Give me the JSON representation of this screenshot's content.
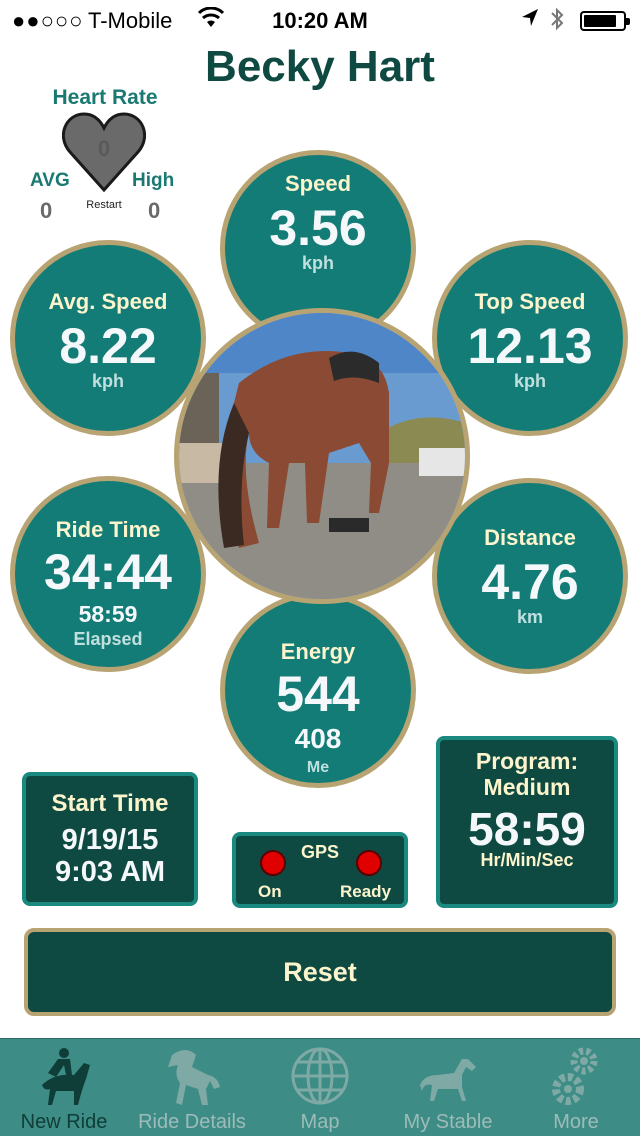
{
  "status_bar": {
    "signal": "●●○○○",
    "carrier": "T-Mobile",
    "time": "10:20 AM",
    "battery_level": 0.85
  },
  "title": "Becky Hart",
  "heart_rate": {
    "title": "Heart Rate",
    "current": "0",
    "avg_label": "AVG",
    "avg_value": "0",
    "high_label": "High",
    "high_value": "0",
    "restart_label": "Restart"
  },
  "stats": {
    "speed": {
      "label": "Speed",
      "value": "3.56",
      "unit": "kph"
    },
    "avg_speed": {
      "label": "Avg. Speed",
      "value": "8.22",
      "unit": "kph"
    },
    "top_speed": {
      "label": "Top Speed",
      "value": "12.13",
      "unit": "kph"
    },
    "ride_time": {
      "label": "Ride Time",
      "value": "34:44",
      "sub_value": "58:59",
      "sub_label": "Elapsed"
    },
    "distance": {
      "label": "Distance",
      "value": "4.76",
      "unit": "km"
    },
    "energy": {
      "label": "Energy",
      "value": "544",
      "sub_value": "408",
      "sub_label": "Me"
    }
  },
  "start_time": {
    "title": "Start Time",
    "date": "9/19/15",
    "time": "9:03 AM"
  },
  "gps": {
    "title": "GPS",
    "on_label": "On",
    "ready_label": "Ready",
    "status_color": "#e00000"
  },
  "program": {
    "title_line1": "Program:",
    "title_line2": "Medium",
    "value": "58:59",
    "unit": "Hr/Min/Sec"
  },
  "reset_label": "Reset",
  "tabs": [
    {
      "label": "New Ride",
      "icon": "rider-icon",
      "active": true
    },
    {
      "label": "Ride Details",
      "icon": "rearing-horse-icon",
      "active": false
    },
    {
      "label": "Map",
      "icon": "globe-icon",
      "active": false
    },
    {
      "label": "My Stable",
      "icon": "horse-icon",
      "active": false
    },
    {
      "label": "More",
      "icon": "gears-icon",
      "active": false
    }
  ],
  "colors": {
    "accent": "#137c76",
    "dark": "#0f4a42",
    "gold": "#b8a372",
    "tabbar": "#3e8c86"
  }
}
